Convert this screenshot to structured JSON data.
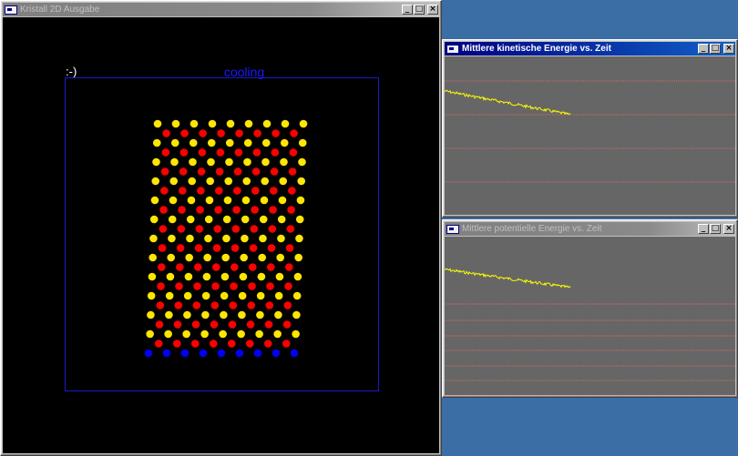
{
  "windows": {
    "main": {
      "title": "Kristall 2D Ausgabe",
      "smiley": ":-)",
      "status": "cooling"
    },
    "kinetic": {
      "title": "Mittlere kinetische Energie vs. Zeit"
    },
    "potential": {
      "title": "Mittlere potentielle Energie vs. Zeit"
    }
  },
  "titlebar_buttons": {
    "minimize": "_",
    "maximize": "□",
    "close": "×"
  },
  "colors": {
    "desktop": "#3a6ea5",
    "particle_a": "#ffe600",
    "particle_b": "#ff0000",
    "particle_base": "#0000ff",
    "energy_line": "#ffff00",
    "guide_line": "#d96b6b"
  }
}
